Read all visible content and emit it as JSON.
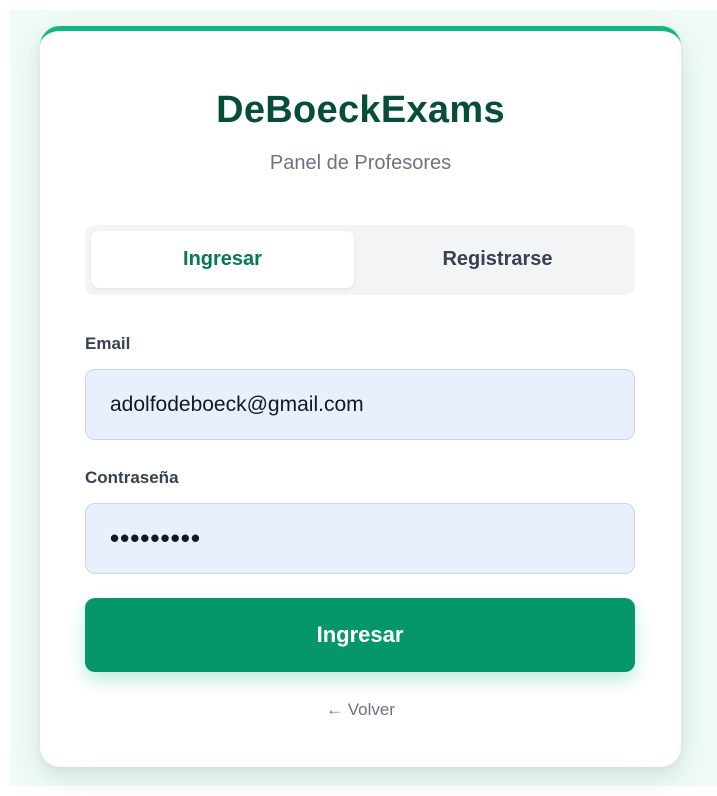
{
  "app": {
    "brand": "DeBoeckExams",
    "subtitle": "Panel de Profesores"
  },
  "tabs": [
    {
      "label": "Ingresar",
      "active": true
    },
    {
      "label": "Registrarse",
      "active": false
    }
  ],
  "form": {
    "email_label": "Email",
    "email_value": "adolfodeboeck@gmail.com",
    "password_label": "Contraseña",
    "password_value": "•••••••••",
    "submit_label": "Ingresar"
  },
  "back_link": "← Volver",
  "colors": {
    "accent": "#059669",
    "brand_text": "#064e3b",
    "autofill_bg": "#e8f0fe"
  }
}
